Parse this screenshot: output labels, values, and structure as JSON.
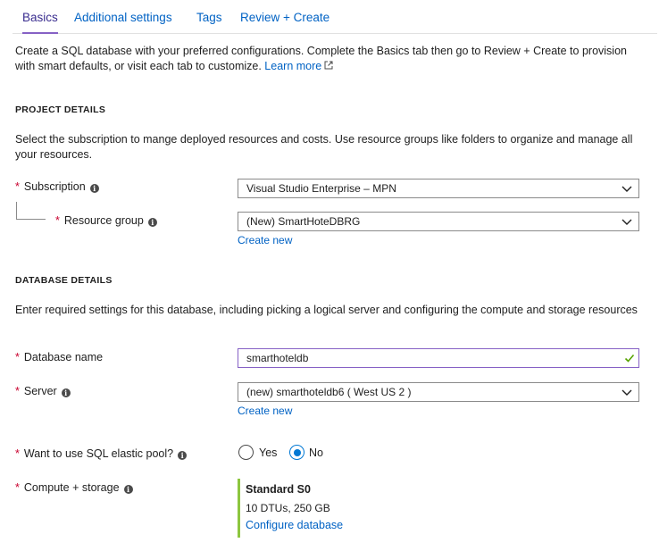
{
  "tabs": [
    {
      "label": "Basics",
      "active": true
    },
    {
      "label": "Additional settings",
      "active": false
    },
    {
      "label": "Tags",
      "active": false
    },
    {
      "label": "Review + Create",
      "active": false
    }
  ],
  "intro": {
    "text": "Create a SQL database with your preferred configurations. Complete the Basics tab then go to Review + Create to provision with smart defaults, or visit each tab to customize.",
    "learn_more": "Learn more"
  },
  "project": {
    "title": "PROJECT DETAILS",
    "description": "Select the subscription to mange deployed resources and costs. Use resource groups like folders to organize and manage all your resources.",
    "subscription_label": "Subscription",
    "subscription_value": "Visual Studio Enterprise – MPN",
    "resource_group_label": "Resource group",
    "resource_group_value": "(New) SmartHoteDBRG",
    "create_new": "Create new"
  },
  "database": {
    "title": "DATABASE DETAILS",
    "description": "Enter required settings for this database, including picking a logical server and configuring the compute and storage resources",
    "name_label": "Database name",
    "name_value": "smarthoteldb",
    "server_label": "Server",
    "server_value": "(new) smarthoteldb6 ( West US 2 )",
    "create_new": "Create new",
    "elastic_label": "Want to use SQL elastic pool?",
    "elastic_yes": "Yes",
    "elastic_no": "No",
    "elastic_selected": "No",
    "compute_label": "Compute + storage",
    "compute_tier": "Standard S0",
    "compute_details": "10 DTUs, 250 GB",
    "compute_link": "Configure database"
  },
  "colors": {
    "link": "#0062c4",
    "required": "#c8002e",
    "accent": "#8661c5",
    "radio": "#0078d4",
    "compute_bar": "#8dc63f",
    "valid_check": "#57a300"
  },
  "icons": {
    "info": "info-icon",
    "external": "external-link-icon",
    "chevron": "chevron-down-icon",
    "check": "checkmark-icon"
  }
}
